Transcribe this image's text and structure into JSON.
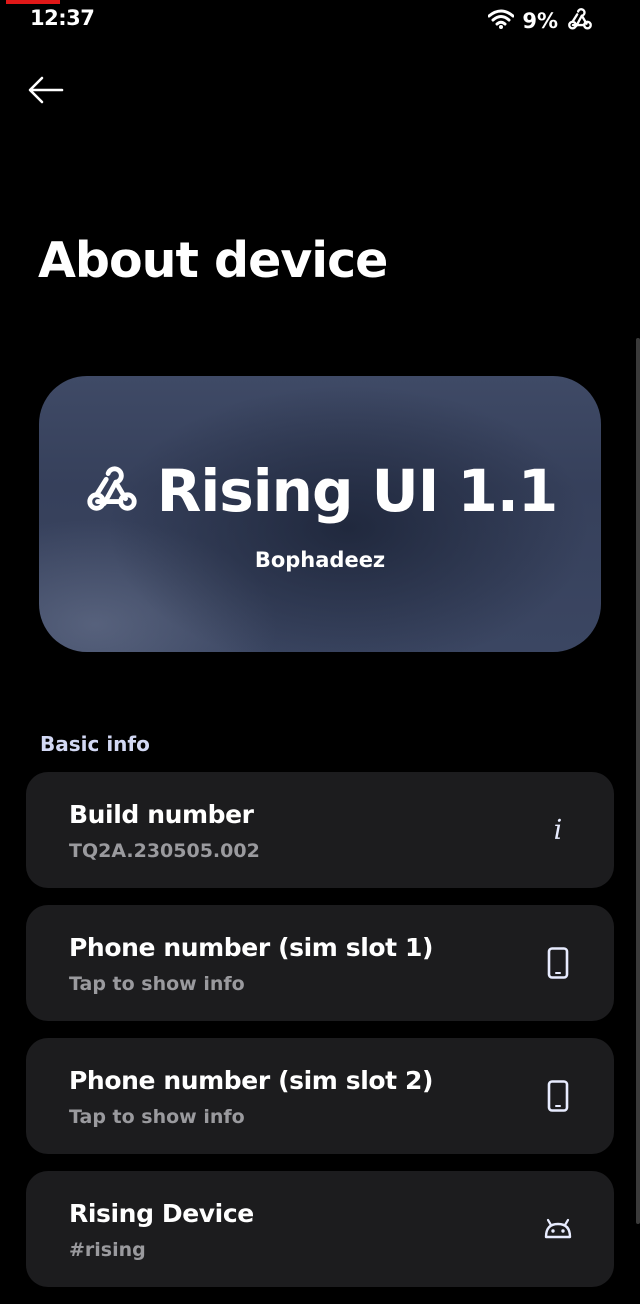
{
  "status_bar": {
    "time": "12:37",
    "battery": "9%",
    "icons": [
      "wifi-icon",
      "rising-logo-icon"
    ]
  },
  "header": {
    "back_icon": "back-arrow-icon",
    "title": "About device"
  },
  "hero": {
    "icon": "rising-logo-icon",
    "title": "Rising UI 1.1",
    "subtitle": "Bophadeez"
  },
  "basic_info": {
    "header": "Basic info",
    "items": [
      {
        "title": "Build number",
        "subtitle": "TQ2A.230505.002",
        "icon": "info-icon"
      },
      {
        "title": "Phone number (sim slot 1)",
        "subtitle": "Tap to show info",
        "icon": "phone-icon"
      },
      {
        "title": "Phone number (sim slot 2)",
        "subtitle": "Tap to show info",
        "icon": "phone-icon"
      },
      {
        "title": "Rising Device",
        "subtitle": "#rising",
        "icon": "android-icon"
      }
    ]
  },
  "colors": {
    "background": "#000000",
    "card": "#1c1c1e",
    "hero": "#3b4662",
    "section_header": "#d2d8f4",
    "subtitle": "#9a9a9e"
  }
}
